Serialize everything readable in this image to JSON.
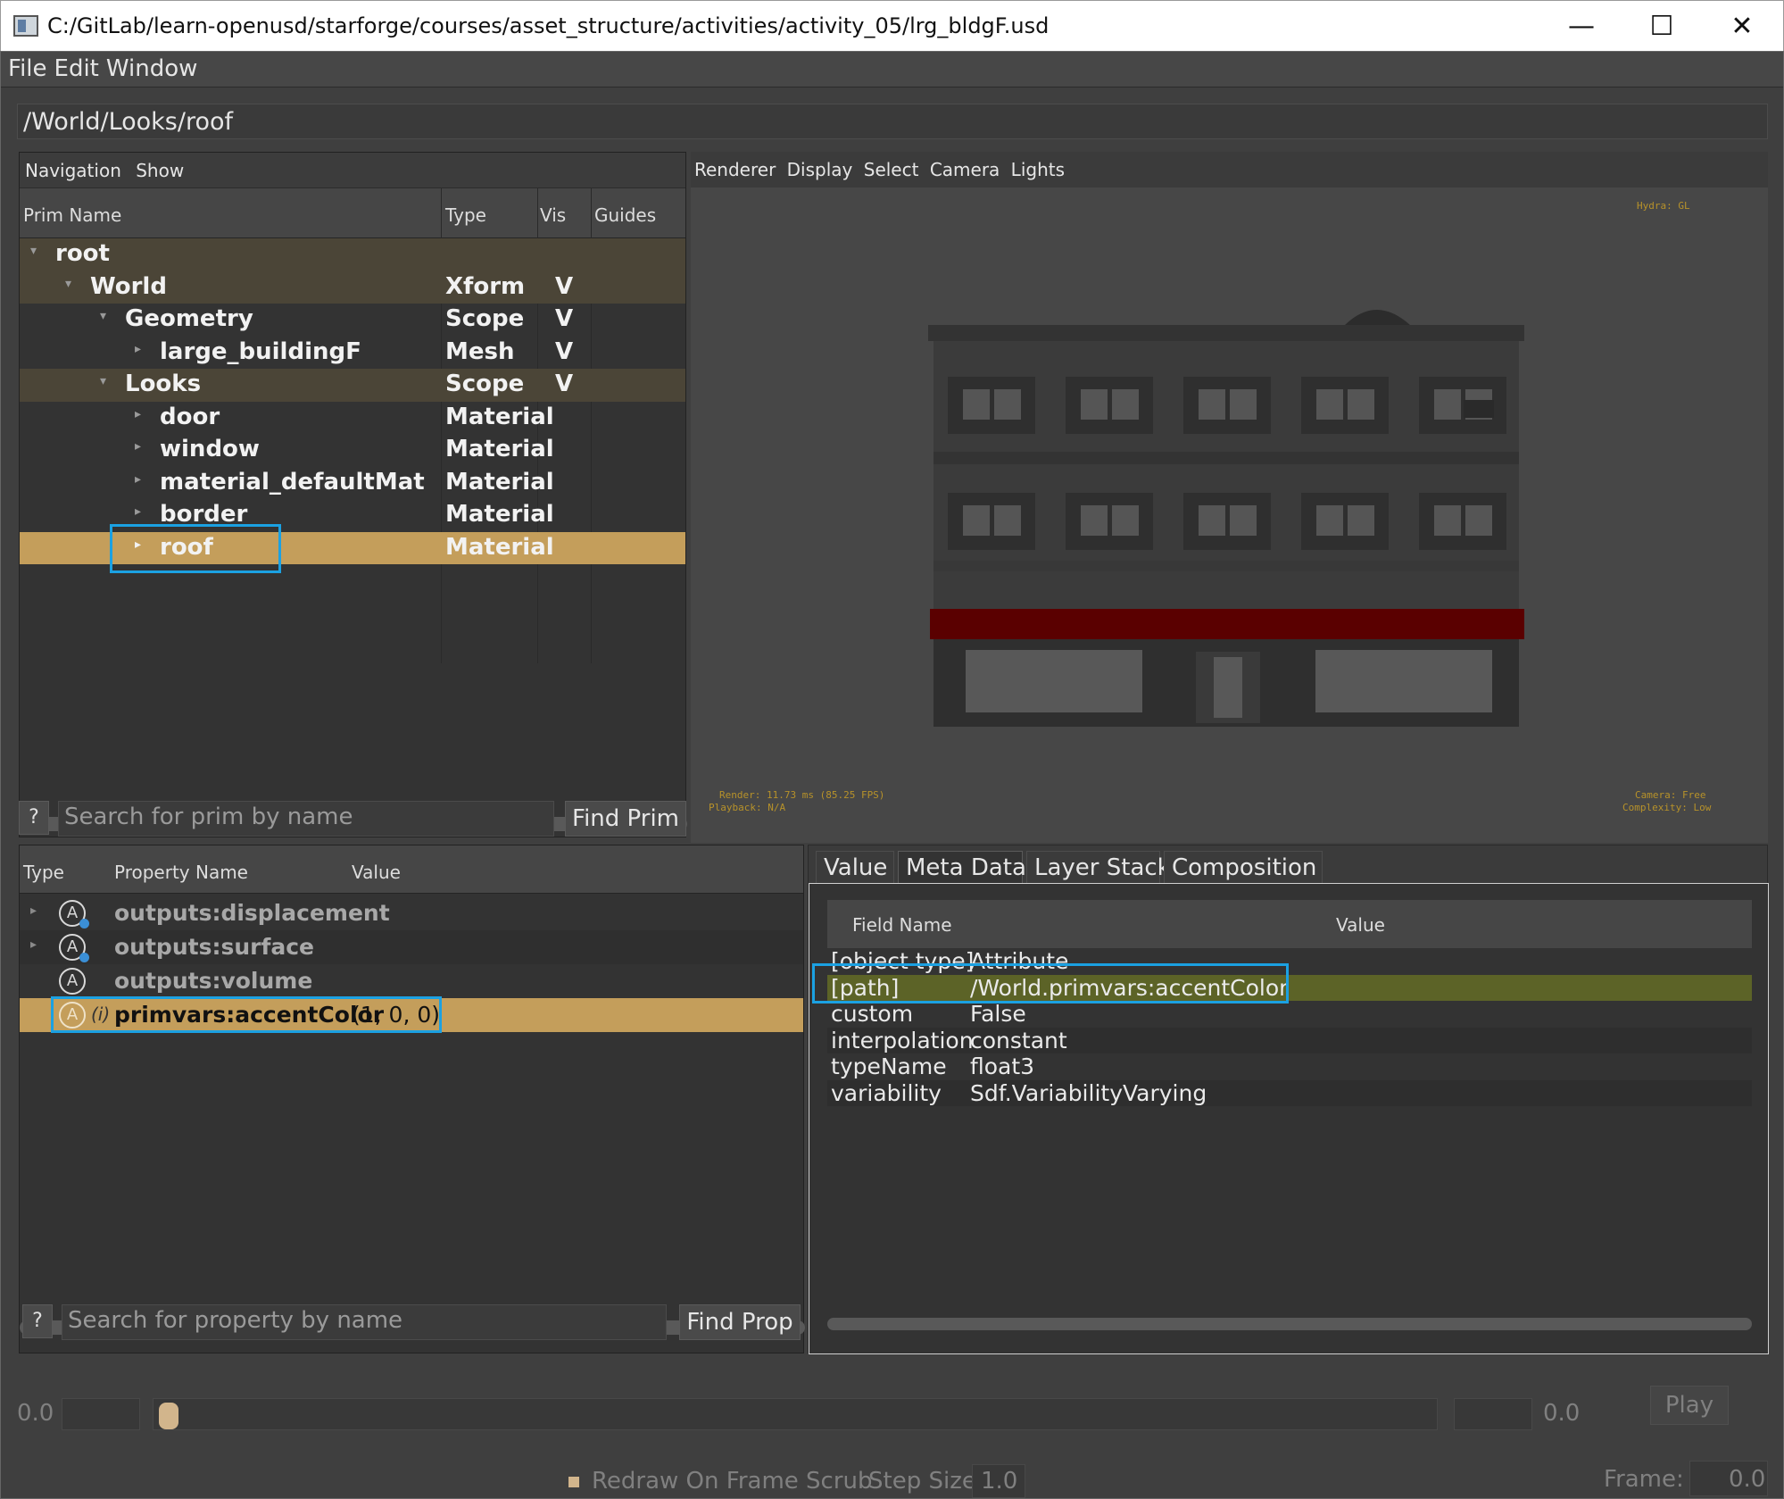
{
  "window": {
    "title": "C:/GitLab/learn-openusd/starforge/courses/asset_structure/activities/activity_05/lrg_bldgF.usd",
    "min_glyph": "—",
    "max_glyph": "☐",
    "close_glyph": "✕"
  },
  "menubar": {
    "file": "File",
    "edit": "Edit",
    "window": "Window"
  },
  "path_bar": {
    "value": "/World/Looks/roof"
  },
  "prim_browser": {
    "menu": {
      "navigation": "Navigation",
      "show": "Show"
    },
    "columns": {
      "name": "Prim Name",
      "type": "Type",
      "vis": "Vis",
      "guides": "Guides"
    },
    "rows": [
      {
        "name": "root",
        "type": "",
        "vis": "",
        "depth": 0,
        "expander": "expanded",
        "style": "group"
      },
      {
        "name": "World",
        "type": "Xform",
        "vis": "V",
        "depth": 1,
        "expander": "expanded",
        "style": "group"
      },
      {
        "name": "Geometry",
        "type": "Scope",
        "vis": "V",
        "depth": 2,
        "expander": "expanded",
        "style": "plain"
      },
      {
        "name": "large_buildingF",
        "type": "Mesh",
        "vis": "V",
        "depth": 3,
        "expander": "collapsed",
        "style": "plain"
      },
      {
        "name": "Looks",
        "type": "Scope",
        "vis": "V",
        "depth": 2,
        "expander": "expanded",
        "style": "group"
      },
      {
        "name": "door",
        "type": "Material",
        "vis": "",
        "depth": 3,
        "expander": "collapsed",
        "style": "plain"
      },
      {
        "name": "window",
        "type": "Material",
        "vis": "",
        "depth": 3,
        "expander": "collapsed",
        "style": "plain"
      },
      {
        "name": "material_defaultMat",
        "type": "Material",
        "vis": "",
        "depth": 3,
        "expander": "collapsed",
        "style": "plain"
      },
      {
        "name": "border",
        "type": "Material",
        "vis": "",
        "depth": 3,
        "expander": "collapsed",
        "style": "plain"
      },
      {
        "name": "roof",
        "type": "Material",
        "vis": "",
        "depth": 3,
        "expander": "collapsed",
        "style": "selected"
      }
    ],
    "help_label": "?",
    "search_placeholder": "Search for prim by name",
    "find_label": "Find Prim"
  },
  "viewport": {
    "menu": {
      "renderer": "Renderer",
      "display": "Display",
      "select": "Select",
      "camera": "Camera",
      "lights": "Lights"
    },
    "hud": {
      "hydra": "Hydra: GL",
      "render": "Render: 11.73 ms (85.25 FPS)",
      "playback": "Playback: N/A",
      "camera": "Camera: Free",
      "complexity": "Complexity: Low"
    },
    "colors": {
      "background": "#474747",
      "facade": "#3a3a3a",
      "awning": "#5a0000",
      "window_glass": "#5b5b5b"
    }
  },
  "property_browser": {
    "columns": {
      "type": "Type",
      "name": "Property Name",
      "value": "Value"
    },
    "rows": [
      {
        "icon": "attribute-icon",
        "icon_letter": "A",
        "connected": true,
        "name": "outputs:displacement",
        "value": "",
        "expander": true,
        "style": "plain"
      },
      {
        "icon": "attribute-icon",
        "icon_letter": "A",
        "connected": true,
        "name": "outputs:surface",
        "value": "",
        "expander": true,
        "style": "alt"
      },
      {
        "icon": "attribute-icon",
        "icon_letter": "A",
        "connected": false,
        "name": "outputs:volume",
        "value": "",
        "expander": false,
        "style": "plain"
      },
      {
        "icon": "attribute-icon",
        "icon_letter": "A",
        "connected": false,
        "interp_mark": "(i)",
        "name": "primvars:accentColor",
        "value": "(1, 0, 0)",
        "expander": false,
        "style": "selected"
      }
    ],
    "help_label": "?",
    "search_placeholder": "Search for property by name",
    "find_label": "Find Prop"
  },
  "inspector": {
    "tabs": [
      "Value",
      "Meta Data",
      "Layer Stack",
      "Composition"
    ],
    "active_tab": "Meta Data",
    "columns": {
      "field": "Field Name",
      "value": "Value"
    },
    "rows": [
      {
        "field": "[object type]",
        "value": "Attribute"
      },
      {
        "field": "[path]",
        "value": "/World.primvars:accentColor"
      },
      {
        "field": "custom",
        "value": "False"
      },
      {
        "field": "interpolation",
        "value": "constant"
      },
      {
        "field": "typeName",
        "value": "float3"
      },
      {
        "field": "variability",
        "value": "Sdf.VariabilityVarying"
      }
    ]
  },
  "timeline": {
    "start": "0.0",
    "end": "0.0",
    "play_label": "Play",
    "redraw_label": "Redraw On Frame Scrub",
    "step_label": "Step Size",
    "step_value": "1.0",
    "frame_label": "Frame:",
    "frame_value": "0.0",
    "slider_fraction": 0.0
  },
  "highlight_color": "#1ba1e2",
  "selection_color": "#c49e5b"
}
